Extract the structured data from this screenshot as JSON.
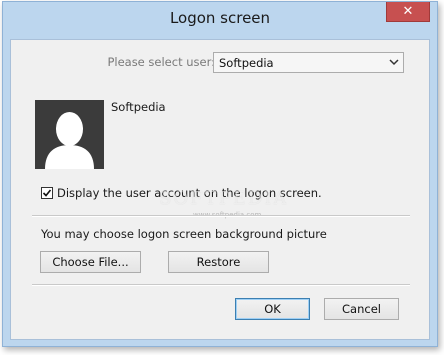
{
  "window": {
    "title": "Logon screen",
    "close_label": "✕"
  },
  "user_select": {
    "label": "Please select user:",
    "value": "Softpedia"
  },
  "account": {
    "name": "Softpedia"
  },
  "display_checkbox": {
    "label": "Display the user account on the logon screen.",
    "checked": true
  },
  "watermark": {
    "text": "SOFTPEDIA",
    "url": "www.softpedia.com"
  },
  "background": {
    "label": "You may choose logon screen background picture",
    "choose_label": "Choose File...",
    "restore_label": "Restore"
  },
  "dialog_buttons": {
    "ok_label": "OK",
    "cancel_label": "Cancel"
  },
  "colors": {
    "frame": "#bcd6ee",
    "close_button": "#c75050",
    "client": "#f0f0f0",
    "avatar_bg": "#3b3b3b"
  }
}
